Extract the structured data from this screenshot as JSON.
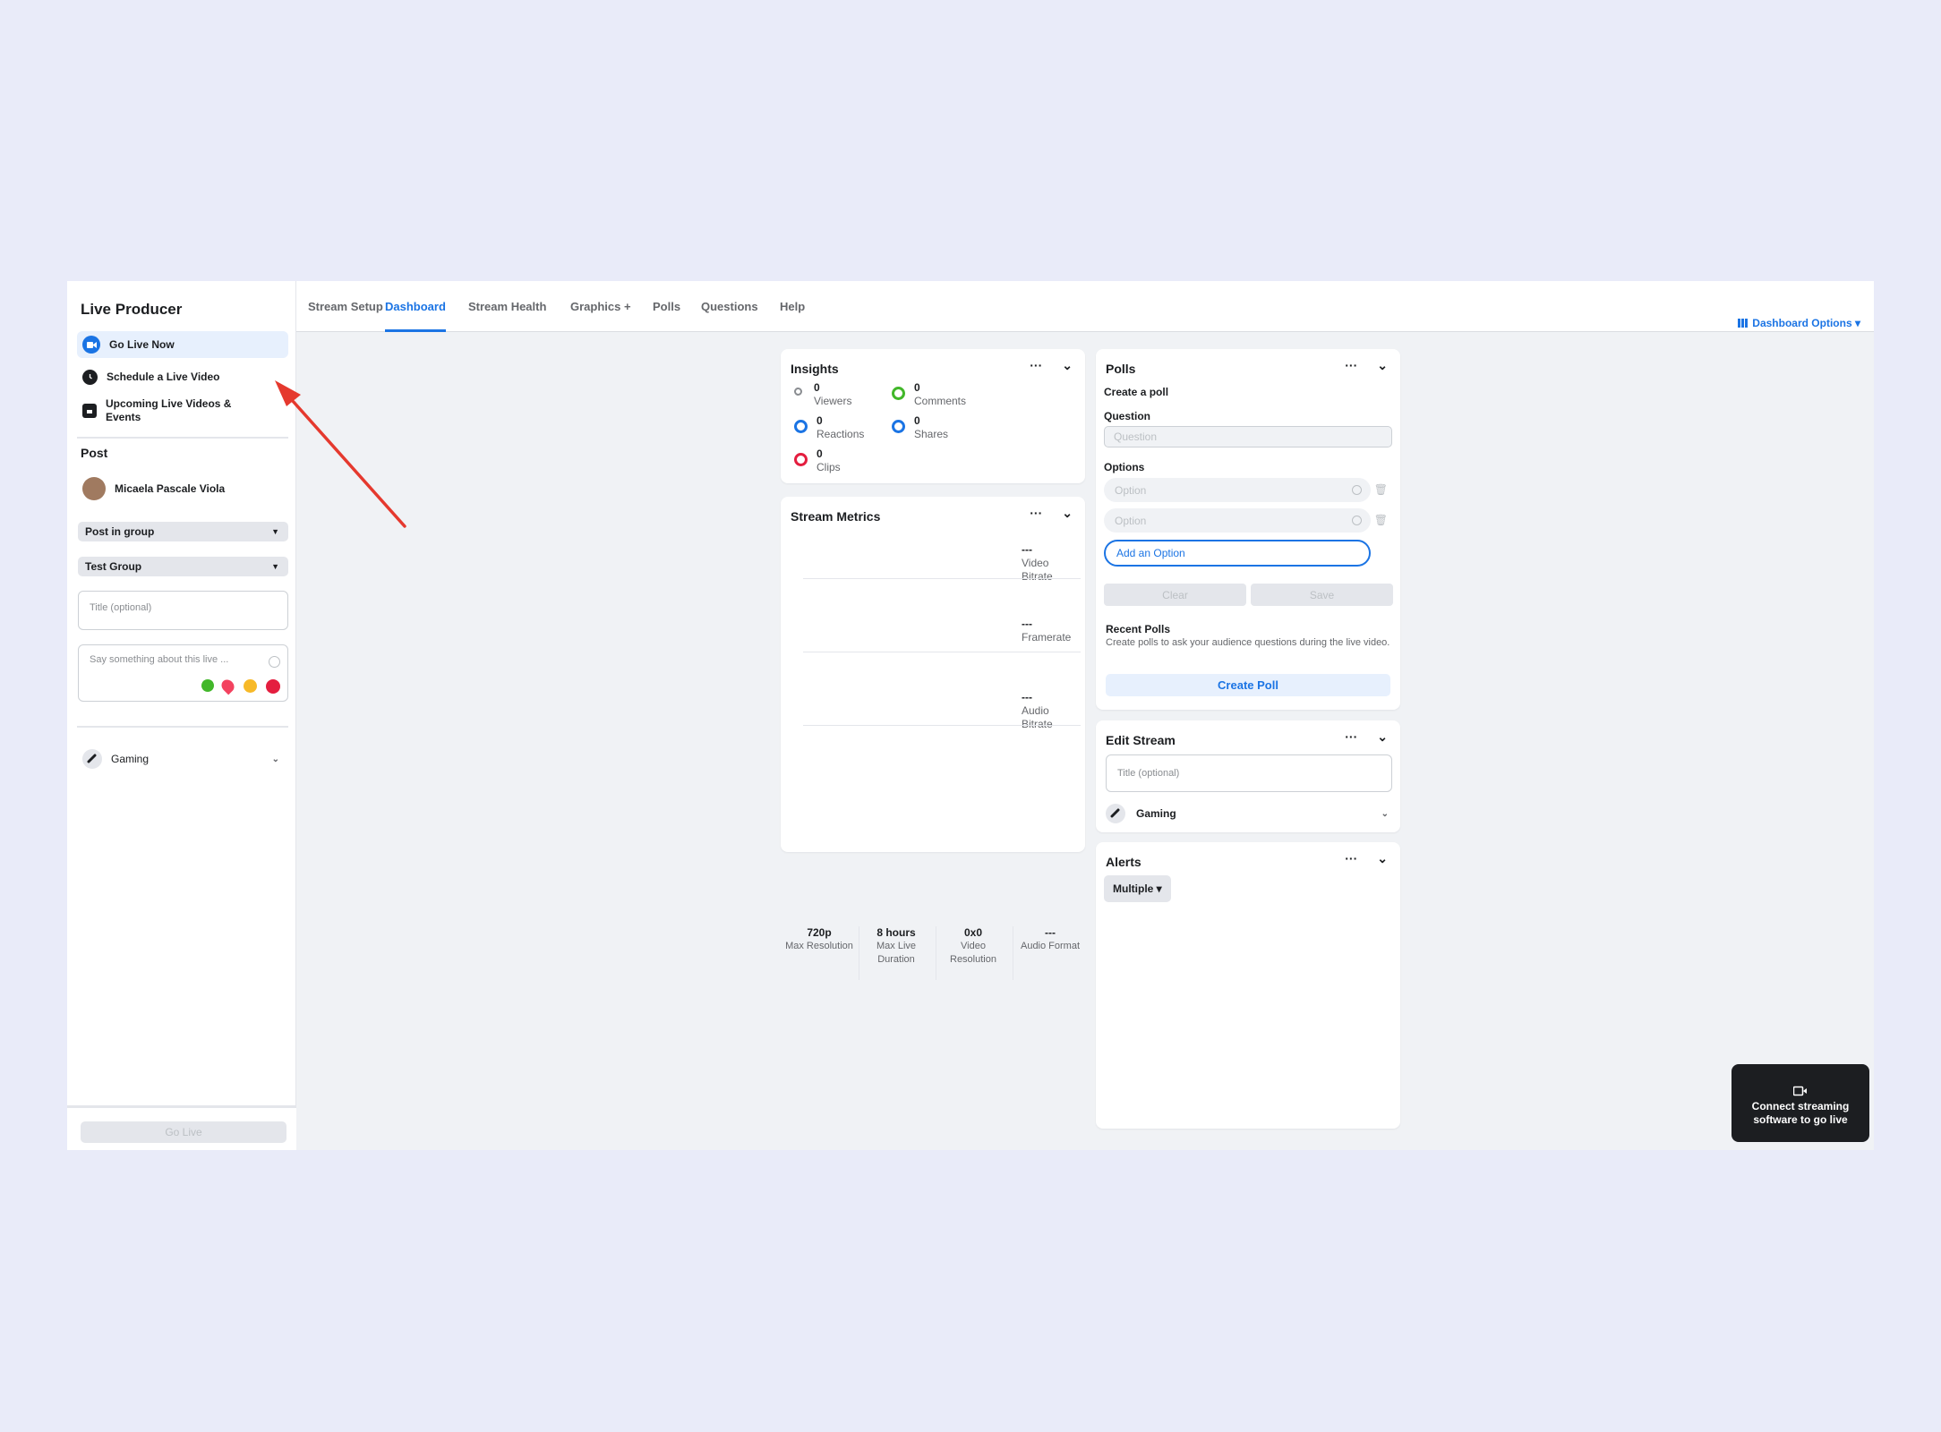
{
  "app_title": "Live Producer",
  "sidebar": {
    "items": [
      {
        "label": "Go Live Now",
        "icon": "video-camera-icon"
      },
      {
        "label": "Schedule a Live Video",
        "icon": "clock-icon"
      },
      {
        "label": "Upcoming Live Videos & Events",
        "icon": "calendar-icon"
      }
    ],
    "post_section": "Post",
    "user_name": "Micaela Pascale Viola",
    "post_dest": "Post in group",
    "group": "Test Group",
    "title_placeholder": "Title (optional)",
    "desc_placeholder": "Say something about this live ...",
    "category": "Gaming",
    "go_live": "Go Live"
  },
  "tabs": [
    "Stream Setup",
    "Dashboard",
    "Stream Health",
    "Graphics +",
    "Polls",
    "Questions",
    "Help"
  ],
  "active_tab": "Dashboard",
  "dashboard_options": "Dashboard Options ▾",
  "insights": {
    "title": "Insights",
    "stats": [
      {
        "value": "0",
        "label": "Viewers",
        "color": "#8a8d91"
      },
      {
        "value": "0",
        "label": "Comments",
        "color": "#42b72a"
      },
      {
        "value": "0",
        "label": "Reactions",
        "color": "#1b74e4"
      },
      {
        "value": "0",
        "label": "Shares",
        "color": "#1b74e4"
      },
      {
        "value": "0",
        "label": "Clips",
        "color": "#e41e3f"
      }
    ]
  },
  "stream_metrics": {
    "title": "Stream Metrics",
    "metrics": [
      {
        "value": "---",
        "label": "Video Bitrate"
      },
      {
        "value": "---",
        "label": "Framerate"
      },
      {
        "value": "---",
        "label": "Audio Bitrate"
      }
    ],
    "footer": [
      {
        "value": "720p",
        "label": "Max Resolution"
      },
      {
        "value": "8 hours",
        "label": "Max Live Duration"
      },
      {
        "value": "0x0",
        "label": "Video Resolution"
      },
      {
        "value": "---",
        "label": "Audio Format"
      }
    ]
  },
  "polls": {
    "title": "Polls",
    "create_label": "Create a poll",
    "question_label": "Question",
    "question_placeholder": "Question",
    "options_label": "Options",
    "option_placeholder": "Option",
    "add_option": "Add an Option",
    "clear": "Clear",
    "save": "Save",
    "recent_title": "Recent Polls",
    "recent_desc": "Create polls to ask your audience questions during the live video.",
    "create_poll": "Create Poll"
  },
  "edit_stream": {
    "title": "Edit Stream",
    "title_placeholder": "Title (optional)",
    "category": "Gaming"
  },
  "alerts": {
    "title": "Alerts",
    "filter": "Multiple ▾"
  },
  "toast": "Connect streaming software to go live",
  "colors": {
    "accent": "#1b74e4",
    "arrow": "#e5392e"
  }
}
